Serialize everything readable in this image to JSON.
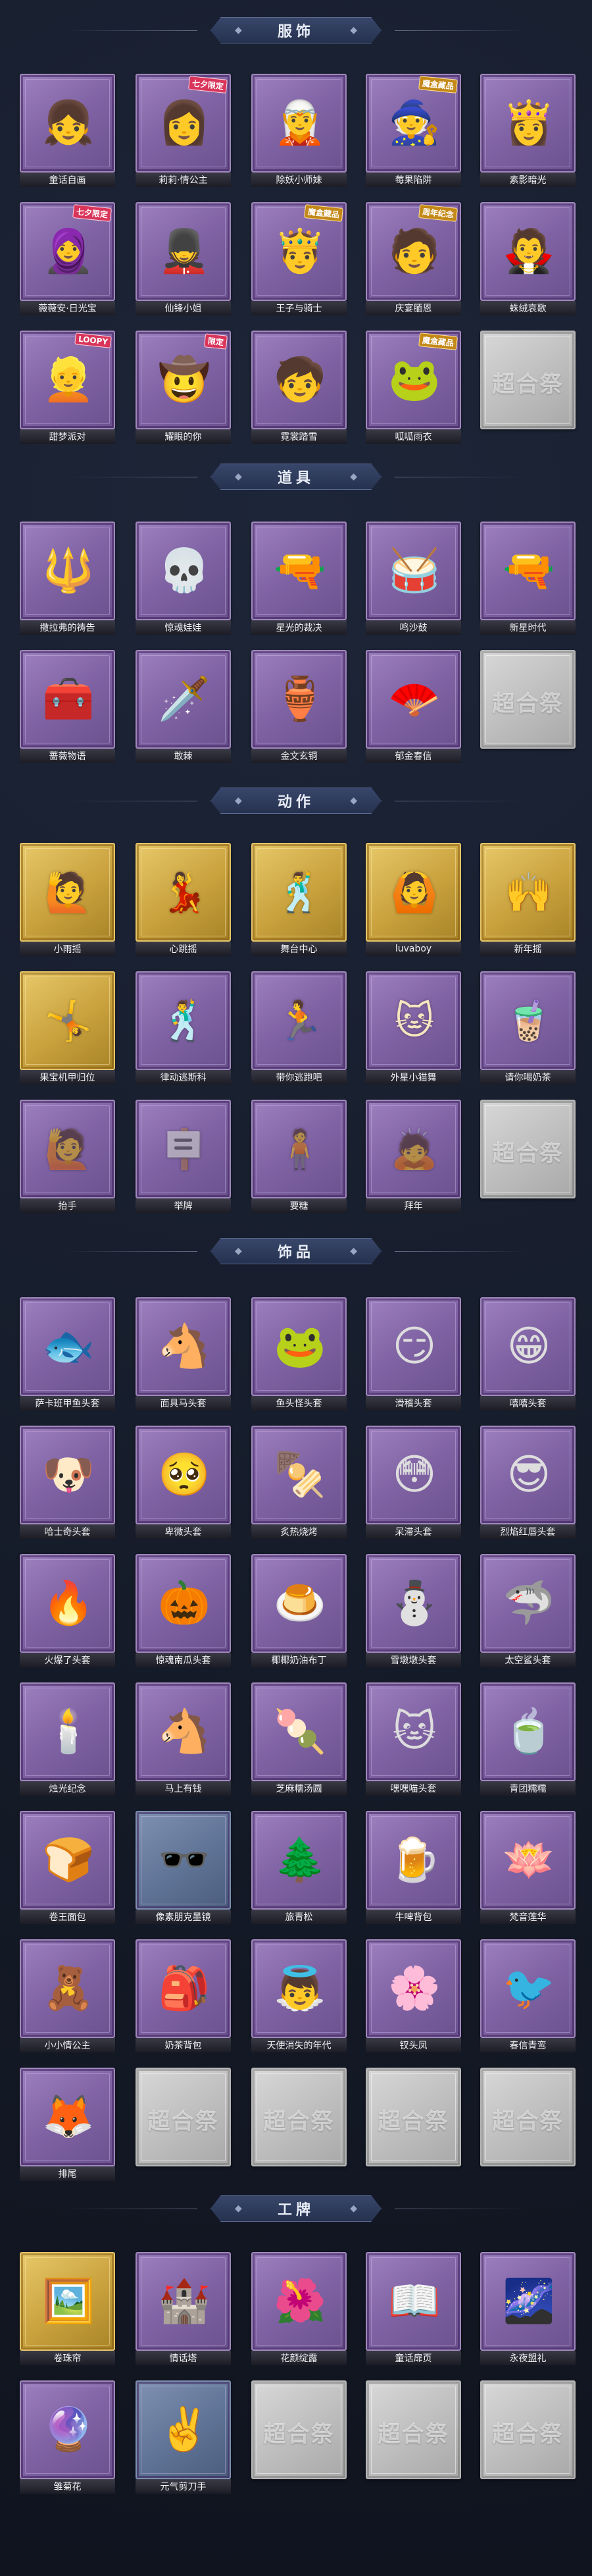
{
  "sections": [
    {
      "id": "costume",
      "title": "服饰",
      "items": [
        {
          "label": "童话自画",
          "glyph": "👧",
          "frame": "purple"
        },
        {
          "label": "莉莉·情公主",
          "glyph": "👩",
          "frame": "purple",
          "stamp": "七夕限定"
        },
        {
          "label": "除妖小师妹",
          "glyph": "🧝",
          "frame": "purple"
        },
        {
          "label": "莓果陷阱",
          "glyph": "🧙",
          "frame": "purple",
          "stamp": "魔盒藏品"
        },
        {
          "label": "素影暗光",
          "glyph": "👸",
          "frame": "purple"
        },
        {
          "label": "薇薇安·日光宝",
          "glyph": "🧕",
          "frame": "purple",
          "stamp": "七夕限定"
        },
        {
          "label": "仙锋小姐",
          "glyph": "💂",
          "frame": "purple"
        },
        {
          "label": "王子与骑士",
          "glyph": "🤴",
          "frame": "purple",
          "stamp": "魔盒藏品"
        },
        {
          "label": "庆宴腼恩",
          "glyph": "🧑",
          "frame": "purple",
          "stamp": "周年纪念"
        },
        {
          "label": "蛛绒哀歌",
          "glyph": "🧛",
          "frame": "purple"
        },
        {
          "label": "甜梦派对",
          "glyph": "👱",
          "frame": "purple",
          "stamp": "LOOPY"
        },
        {
          "label": "耀眼的你",
          "glyph": "🤠",
          "frame": "purple",
          "stamp": "限定"
        },
        {
          "label": "霓裳踏雪",
          "glyph": "🧒",
          "frame": "purple"
        },
        {
          "label": "呱呱雨衣",
          "glyph": "🐸",
          "frame": "purple",
          "stamp": "魔盒藏品"
        },
        {
          "label": "",
          "glyph": "",
          "frame": "empty",
          "empty_text": "超合祭"
        }
      ]
    },
    {
      "id": "props",
      "title": "道具",
      "items": [
        {
          "label": "撒拉弗的祷告",
          "glyph": "🔱",
          "frame": "purple"
        },
        {
          "label": "惊魂娃娃",
          "glyph": "💀",
          "frame": "purple"
        },
        {
          "label": "星光的裁决",
          "glyph": "🔫",
          "frame": "purple"
        },
        {
          "label": "鸣沙鼓",
          "glyph": "🥁",
          "frame": "purple"
        },
        {
          "label": "新星时代",
          "glyph": "🔫",
          "frame": "purple"
        },
        {
          "label": "蔷薇物语",
          "glyph": "🧰",
          "frame": "purple"
        },
        {
          "label": "敢棘",
          "glyph": "🗡️",
          "frame": "purple"
        },
        {
          "label": "金文玄铜",
          "glyph": "🏺",
          "frame": "purple"
        },
        {
          "label": "郁金春信",
          "glyph": "🪭",
          "frame": "purple"
        },
        {
          "label": "",
          "glyph": "",
          "frame": "empty",
          "empty_text": "超合祭"
        }
      ]
    },
    {
      "id": "actions",
      "title": "动作",
      "items": [
        {
          "label": "小雨摇",
          "glyph": "🙋",
          "frame": "gold",
          "pose": true
        },
        {
          "label": "心跳摇",
          "glyph": "💃",
          "frame": "gold",
          "pose": true
        },
        {
          "label": "舞台中心",
          "glyph": "🕺",
          "frame": "gold",
          "pose": true
        },
        {
          "label": "luvaboy",
          "glyph": "🙆",
          "frame": "gold",
          "pose": true
        },
        {
          "label": "新年摇",
          "glyph": "🙌",
          "frame": "gold",
          "pose": true
        },
        {
          "label": "果宝机甲归位",
          "glyph": "🤸",
          "frame": "gold",
          "pose": true
        },
        {
          "label": "律动逃斯科",
          "glyph": "🕺",
          "frame": "purple",
          "pose": true
        },
        {
          "label": "带你逃跑吧",
          "glyph": "🏃",
          "frame": "purple",
          "pose": true
        },
        {
          "label": "外星小猫舞",
          "glyph": "🐱",
          "frame": "purple",
          "pose": true
        },
        {
          "label": "请你喝奶茶",
          "glyph": "🧋",
          "frame": "purple",
          "pose": true
        },
        {
          "label": "抬手",
          "glyph": "🙋",
          "frame": "purple",
          "pose": true,
          "ghost": true
        },
        {
          "label": "举牌",
          "glyph": "🪧",
          "frame": "purple",
          "pose": true,
          "ghost": true
        },
        {
          "label": "要糖",
          "glyph": "🧍",
          "frame": "purple",
          "pose": true,
          "ghost": true
        },
        {
          "label": "拜年",
          "glyph": "🙇",
          "frame": "purple",
          "pose": true,
          "ghost": true
        },
        {
          "label": "",
          "glyph": "",
          "frame": "empty",
          "empty_text": "超合祭"
        }
      ]
    },
    {
      "id": "accessories",
      "title": "饰品",
      "items": [
        {
          "label": "萨卡班甲鱼头套",
          "glyph": "🐟",
          "frame": "purple"
        },
        {
          "label": "面具马头套",
          "glyph": "🐴",
          "frame": "purple"
        },
        {
          "label": "鱼头怪头套",
          "glyph": "🐸",
          "frame": "purple"
        },
        {
          "label": "滑稽头套",
          "glyph": "😏",
          "frame": "purple"
        },
        {
          "label": "嘻嘻头套",
          "glyph": "😁",
          "frame": "purple"
        },
        {
          "label": "哈士奇头套",
          "glyph": "🐶",
          "frame": "purple"
        },
        {
          "label": "卑微头套",
          "glyph": "🥺",
          "frame": "purple"
        },
        {
          "label": "炙热烧烤",
          "glyph": "🍢",
          "frame": "purple"
        },
        {
          "label": "呆滞头套",
          "glyph": "😳",
          "frame": "purple"
        },
        {
          "label": "烈焰红唇头套",
          "glyph": "😎",
          "frame": "purple"
        },
        {
          "label": "火爆了头套",
          "glyph": "🔥",
          "frame": "purple"
        },
        {
          "label": "惊魂南瓜头套",
          "glyph": "🎃",
          "frame": "purple"
        },
        {
          "label": "椰椰奶油布丁",
          "glyph": "🍮",
          "frame": "purple"
        },
        {
          "label": "雪墩墩头套",
          "glyph": "⛄",
          "frame": "purple"
        },
        {
          "label": "太空鲨头套",
          "glyph": "🦈",
          "frame": "purple"
        },
        {
          "label": "烛光纪念",
          "glyph": "🕯️",
          "frame": "purple"
        },
        {
          "label": "马上有钱",
          "glyph": "🐴",
          "frame": "purple"
        },
        {
          "label": "芝麻糯汤圆",
          "glyph": "🍡",
          "frame": "purple"
        },
        {
          "label": "嘿嘿喵头套",
          "glyph": "🐱",
          "frame": "purple"
        },
        {
          "label": "青团糯糯",
          "glyph": "🍵",
          "frame": "purple"
        },
        {
          "label": "卷王面包",
          "glyph": "🍞",
          "frame": "purple"
        },
        {
          "label": "像素朋克墨镜",
          "glyph": "🕶️",
          "frame": "blue"
        },
        {
          "label": "旅青松",
          "glyph": "🌲",
          "frame": "purple"
        },
        {
          "label": "牛啤背包",
          "glyph": "🍺",
          "frame": "purple"
        },
        {
          "label": "梵音莲华",
          "glyph": "🪷",
          "frame": "purple"
        },
        {
          "label": "小小情公主",
          "glyph": "🧸",
          "frame": "purple"
        },
        {
          "label": "奶茶背包",
          "glyph": "🎒",
          "frame": "purple"
        },
        {
          "label": "天使消失的年代",
          "glyph": "👼",
          "frame": "purple"
        },
        {
          "label": "钗头凤",
          "glyph": "🌸",
          "frame": "purple"
        },
        {
          "label": "春信青鸾",
          "glyph": "🐦",
          "frame": "purple"
        },
        {
          "label": "排尾",
          "glyph": "🦊",
          "frame": "purple"
        },
        {
          "label": "",
          "glyph": "",
          "frame": "empty",
          "empty_text": "超合祭"
        },
        {
          "label": "",
          "glyph": "",
          "frame": "empty",
          "empty_text": "超合祭"
        },
        {
          "label": "",
          "glyph": "",
          "frame": "empty",
          "empty_text": "超合祭"
        },
        {
          "label": "",
          "glyph": "",
          "frame": "empty",
          "empty_text": "超合祭"
        }
      ]
    },
    {
      "id": "badges",
      "title": "工牌",
      "items": [
        {
          "label": "卷珠帘",
          "glyph": "🖼️",
          "frame": "gold"
        },
        {
          "label": "情话塔",
          "glyph": "🏰",
          "frame": "purple"
        },
        {
          "label": "花颜绽露",
          "glyph": "🌺",
          "frame": "purple"
        },
        {
          "label": "童话扉页",
          "glyph": "📖",
          "frame": "purple"
        },
        {
          "label": "永夜盟礼",
          "glyph": "🌌",
          "frame": "purple"
        },
        {
          "label": "雏菊花",
          "glyph": "🔮",
          "frame": "purple"
        },
        {
          "label": "元气剪刀手",
          "glyph": "✌️",
          "frame": "blue"
        },
        {
          "label": "",
          "glyph": "",
          "frame": "empty",
          "empty_text": "超合祭"
        },
        {
          "label": "",
          "glyph": "",
          "frame": "empty",
          "empty_text": "超合祭"
        },
        {
          "label": "",
          "glyph": "",
          "frame": "empty",
          "empty_text": "超合祭"
        }
      ]
    }
  ]
}
